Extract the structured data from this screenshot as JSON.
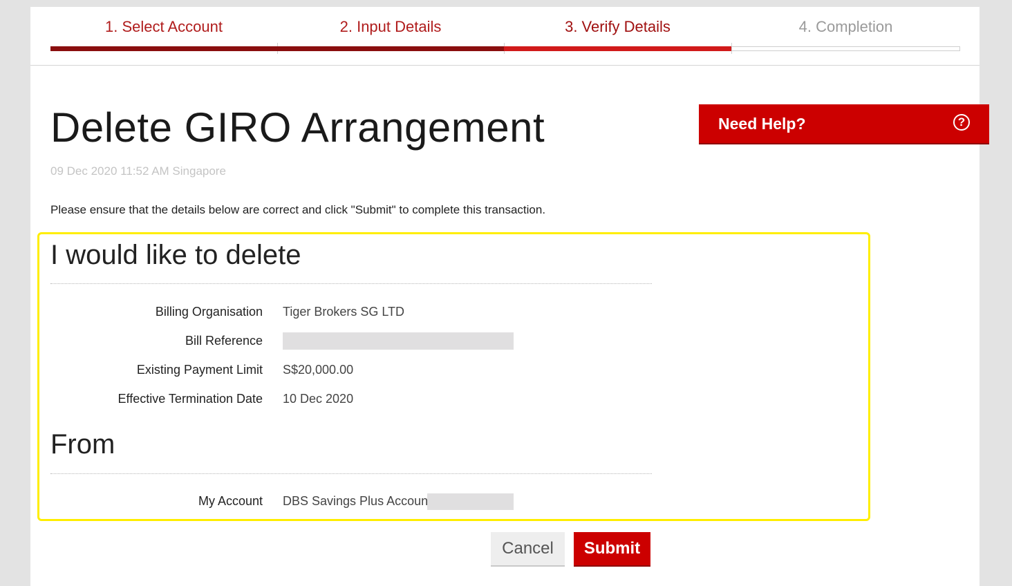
{
  "stepper": {
    "steps": [
      {
        "label": "1. Select Account",
        "state": "done"
      },
      {
        "label": "2. Input Details",
        "state": "done"
      },
      {
        "label": "3. Verify Details",
        "state": "current"
      },
      {
        "label": "4. Completion",
        "state": "todo"
      }
    ]
  },
  "header": {
    "title": "Delete GIRO Arrangement",
    "timestamp": "09 Dec 2020 11:52 AM Singapore"
  },
  "help": {
    "label": "Need Help?",
    "icon": "help-circle-icon",
    "icon_glyph": "?"
  },
  "instruction": "Please ensure that the details below are correct and click \"Submit\" to complete this transaction.",
  "delete_section": {
    "heading": "I would like to delete",
    "rows": [
      {
        "label": "Billing Organisation",
        "value": "Tiger Brokers SG LTD"
      },
      {
        "label": "Bill Reference",
        "value": ""
      },
      {
        "label": "Existing Payment Limit",
        "value": "S$20,000.00"
      },
      {
        "label": "Effective Termination Date",
        "value": "10 Dec 2020"
      }
    ]
  },
  "from_section": {
    "heading": "From",
    "rows": [
      {
        "label": "My Account",
        "value": "DBS Savings Plus Account"
      }
    ]
  },
  "actions": {
    "cancel_label": "Cancel",
    "submit_label": "Submit"
  },
  "colors": {
    "brand_red": "#cc0000",
    "step_done": "#8a0e0e",
    "highlight": "#ffee00"
  }
}
